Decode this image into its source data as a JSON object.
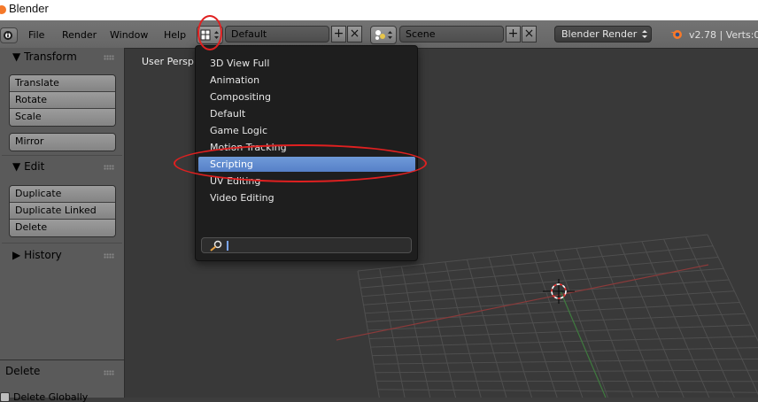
{
  "window": {
    "title": "Blender"
  },
  "menu": {
    "items": [
      "File",
      "Render",
      "Window",
      "Help"
    ]
  },
  "screen_layout": {
    "value": "Default",
    "add": "+",
    "remove": "×"
  },
  "scene": {
    "value": "Scene",
    "add": "+",
    "remove": "×"
  },
  "render_engine": {
    "value": "Blender Render"
  },
  "status": {
    "text": "v2.78 | Verts:0"
  },
  "toolshelf": {
    "transform": {
      "title": "Transform",
      "buttons": [
        "Translate",
        "Rotate",
        "Scale"
      ],
      "mirror": "Mirror"
    },
    "edit": {
      "title": "Edit",
      "buttons": [
        "Duplicate",
        "Duplicate Linked",
        "Delete"
      ]
    },
    "history": {
      "title": "History"
    },
    "delete_panel": {
      "title": "Delete",
      "option": "Delete Globally"
    }
  },
  "viewport": {
    "label": "User Persp"
  },
  "dropdown": {
    "items": [
      "3D View Full",
      "Animation",
      "Compositing",
      "Default",
      "Game Logic",
      "Motion Tracking",
      "Scripting",
      "UV Editing",
      "Video Editing"
    ],
    "selected": "Scripting",
    "search_value": ""
  },
  "colors": {
    "highlight": "#5e8bd0",
    "annotation": "#e02020",
    "header": "#6d6d6d",
    "viewport": "#393939"
  }
}
